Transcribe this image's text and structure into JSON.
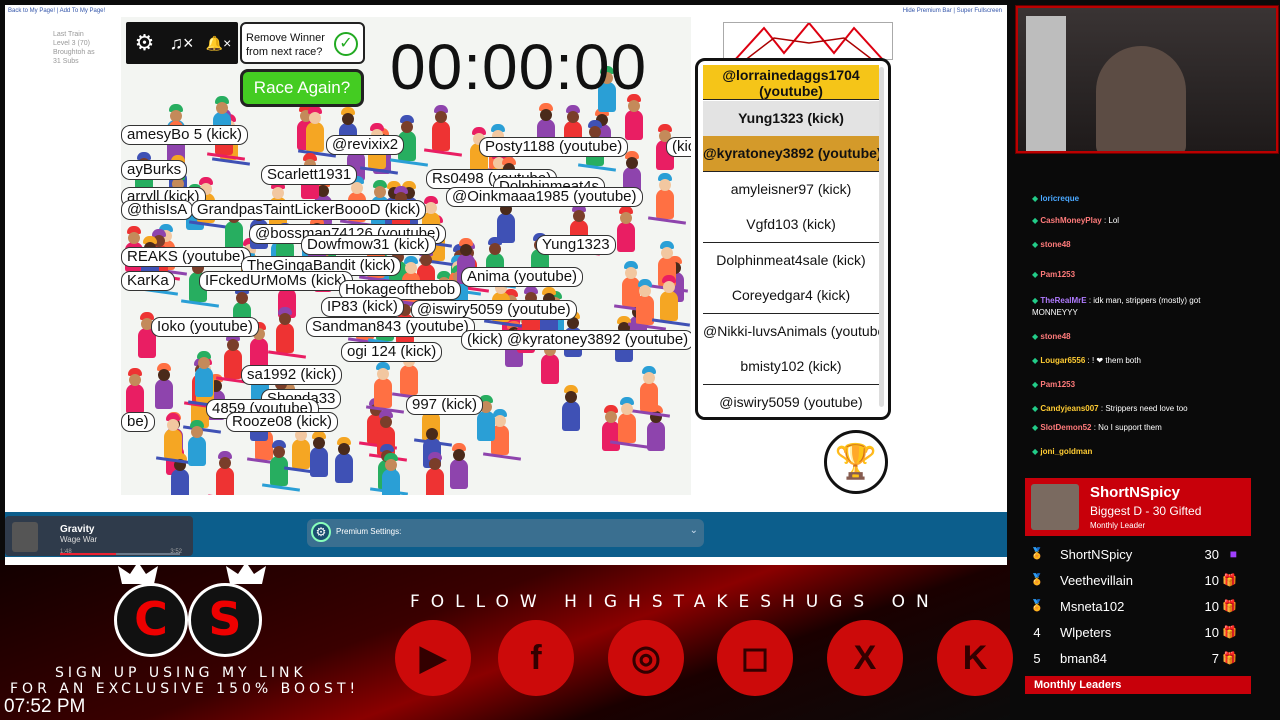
{
  "browser": {
    "top_links_left": "Back to My Page! | Add To My Page!",
    "top_links_right": "Hide Premium Bar | Super Fullscreen",
    "user_stats": [
      "Last Train",
      "Level 3 (70)",
      "Broughtoh as",
      "31 Subs"
    ]
  },
  "controls": {
    "settings_icon": "gear-icon",
    "music_mute_icon": "music-off-icon",
    "bell_mute_icon": "bell-off-icon",
    "settings_glyph": "⚙",
    "music_glyph": "♫×",
    "bell_glyph": "🔔×"
  },
  "remove_winner": {
    "label": "Remove Winner from next race?",
    "check_glyph": "✓"
  },
  "race_again_label": "Race Again?",
  "timer": "00:00:00",
  "race_labels": [
    "amesyBo  5 (kick)",
    "@revixix2",
    "Posty1188 (youtube)",
    "(kick)",
    "ayBurks",
    "Scarlett1931",
    "Rs0498 (youtube)",
    "Dolphinmeat4s",
    "arryll (kick)",
    "@Oinkmaaa1985 (youtube)",
    "@thisIsA",
    "GrandpasTaintLickerBoooD (kick)",
    "@bossman74126 (youtube)",
    "Dowfmow31 (kick)",
    "Yung1323",
    "REAKS (youtube)",
    "TheGingaBandit (kick)",
    "IFckedUrMoMs (kick)",
    "KarKa",
    "Hokageofthebob",
    "Anima (youtube)",
    "IP83 (kick)",
    "@iswiry5059 (youtube)",
    "Sandman843 (youtube)",
    "Ioko (youtube)",
    "(kick) @kyratoney3892 (youtube)",
    "ogi 124 (kick)",
    "sa1992 (kick)",
    "Shonda33",
    "997 (kick)",
    "4859 (youtube)",
    "Rooze08 (kick)",
    "be)"
  ],
  "leaderboard": [
    {
      "name": "@lorrainedaggs1704 (youtube)",
      "style": "gold"
    },
    {
      "name": "Yung1323 (kick)",
      "style": "silver"
    },
    {
      "name": "@kyratoney3892 (youtube)",
      "style": "bronze"
    },
    {
      "name": "amyleisner97 (kick)",
      "style": "plain"
    },
    {
      "name": "Vgfd103 (kick)",
      "style": "plain"
    },
    {
      "name": "Dolphinmeat4sale (kick)",
      "style": "plain"
    },
    {
      "name": "Coreyedgar4 (kick)",
      "style": "plain"
    },
    {
      "name": "@Nikki-luvsAnimals (youtube)",
      "style": "plain"
    },
    {
      "name": "bmisty102 (kick)",
      "style": "plain"
    },
    {
      "name": "@iswiry5059 (youtube)",
      "style": "plain"
    }
  ],
  "trophy_icon": "trophy-icon",
  "trophy_glyph": "🏆",
  "player": {
    "title": "Gravity",
    "artist": "Wage War",
    "elapsed": "1:48",
    "duration": "3:52",
    "progress": 0.47
  },
  "premium": {
    "label": "Premium Settings:",
    "gear_glyph": "⚙",
    "chevron_glyph": "⌄"
  },
  "chat": [
    {
      "user": "loricreque",
      "msg": "",
      "color": "#4aa8ff"
    },
    {
      "user": "CashMoneyPlay",
      "msg": "Lol",
      "color": "#ff7b7b"
    },
    {
      "user": "stone48",
      "msg": "",
      "color": "#ff7b7b"
    },
    {
      "user": "Pam1253",
      "msg": "",
      "color": "#ff7b7b"
    },
    {
      "user": "TheRealMrE",
      "msg": "idk man, strippers (mostly) got MONNEYYY",
      "color": "#b07bff"
    },
    {
      "user": "stone48",
      "msg": "",
      "color": "#ff7b7b"
    },
    {
      "user": "Lougar6556",
      "msg": "! ❤ them both",
      "color": "#ffcc33"
    },
    {
      "user": "Pam1253",
      "msg": "",
      "color": "#ff7b7b"
    },
    {
      "user": "Candyjeans007",
      "msg": "Strippers need love too",
      "color": "#ffcc33"
    },
    {
      "user": "SlotDemon52",
      "msg": "No I support them",
      "color": "#ff7b7b"
    },
    {
      "user": "joni_goldman",
      "msg": "",
      "color": "#ffcc33"
    }
  ],
  "follow_text": "FOLLOW HIGHSTAKESHUGS ON",
  "socials": [
    {
      "name": "youtube-icon",
      "glyph": "▶"
    },
    {
      "name": "facebook-icon",
      "glyph": "f"
    },
    {
      "name": "discord-icon",
      "glyph": "◎"
    },
    {
      "name": "instagram-icon",
      "glyph": "◻"
    },
    {
      "name": "x-icon",
      "glyph": "X"
    },
    {
      "name": "kick-icon",
      "glyph": "K"
    }
  ],
  "logo_letters": [
    "C",
    "S"
  ],
  "signup_line1": "SIGN UP USING MY LINK",
  "signup_line2": "FOR AN EXCLUSIVE 150% BOOST!",
  "clock": "07:52 PM",
  "leader_card": {
    "name": "ShortNSpicy",
    "subtitle": "Biggest D - 30 Gifted",
    "period": "Monthly Leader"
  },
  "leaders": [
    {
      "rank": "🏅",
      "name": "ShortNSpicy",
      "value": "30",
      "icon": "gift-icon"
    },
    {
      "rank": "🏅",
      "name": "Veethevillain",
      "value": "10",
      "icon": "gift-icon"
    },
    {
      "rank": "🏅",
      "name": "Msneta102",
      "value": "10",
      "icon": "gift-icon"
    },
    {
      "rank": "4",
      "name": "Wlpeters",
      "value": "10",
      "icon": "gift-icon"
    },
    {
      "rank": "5",
      "name": "bman84",
      "value": "7",
      "icon": "gift-icon"
    }
  ],
  "leaders_footer": "Monthly Leaders",
  "colors": {
    "brand_red": "#c8000a",
    "green_button": "#44cc22",
    "gold": "#f5c518",
    "bronze": "#d49a2a"
  }
}
